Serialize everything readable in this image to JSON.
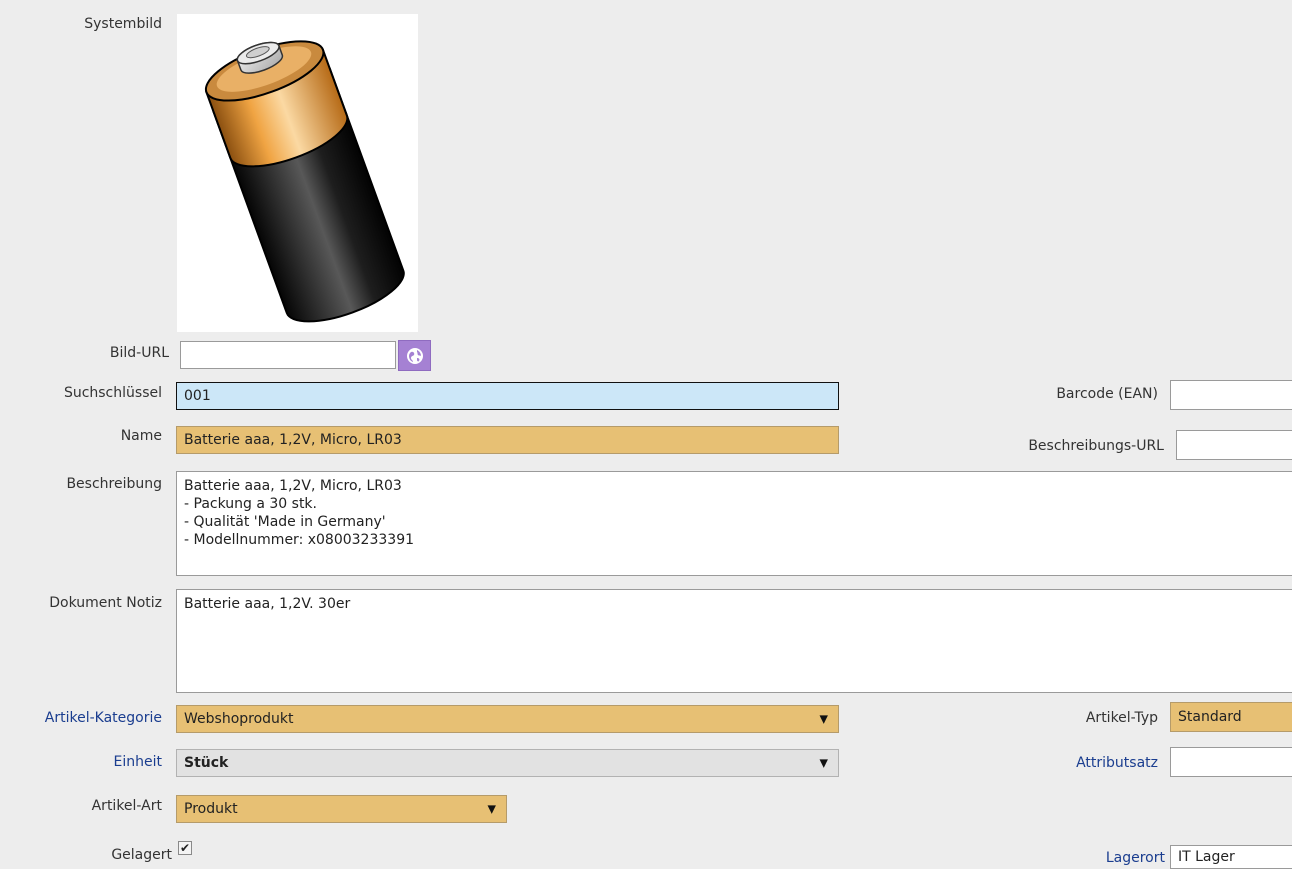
{
  "labels": {
    "systembild": "Systembild",
    "bild_url": "Bild-URL",
    "suchschluessel": "Suchschlüssel",
    "name": "Name",
    "beschreibung": "Beschreibung",
    "dokument_notiz": "Dokument Notiz",
    "artikel_kategorie": "Artikel-Kategorie",
    "einheit": "Einheit",
    "artikel_art": "Artikel-Art",
    "gelagert": "Gelagert",
    "barcode": "Barcode (EAN)",
    "beschreibungs_url": "Beschreibungs-URL",
    "artikel_typ": "Artikel-Typ",
    "attributsatz": "Attributsatz",
    "lagerort": "Lagerort"
  },
  "values": {
    "bild_url": "",
    "suchschluessel": "001",
    "name": "Batterie aaa, 1,2V, Micro, LR03",
    "beschreibung": [
      "Batterie aaa, 1,2V, Micro, LR03",
      "- Packung a 30 stk.",
      "- Qualität 'Made in Germany'",
      "- Modellnummer: x08003233391"
    ],
    "dokument_notiz": "Batterie aaa, 1,2V. 30er",
    "artikel_kategorie": "Webshoprodukt",
    "einheit": "Stück",
    "artikel_art": "Produkt",
    "gelagert": true,
    "barcode": "",
    "beschreibungs_url": "",
    "artikel_typ": "Standard",
    "attributsatz": "",
    "lagerort": "IT Lager"
  },
  "icons": {
    "bild_url_button": "globe-icon",
    "dropdown": "triangle-down",
    "checkbox": "checkmark",
    "image": "battery-image"
  },
  "colors": {
    "background": "#ededed",
    "required_field": "#e7c074",
    "focused_field": "#cce7f8",
    "link_label": "#1a3d8f",
    "globe_button": "#a581d3"
  }
}
